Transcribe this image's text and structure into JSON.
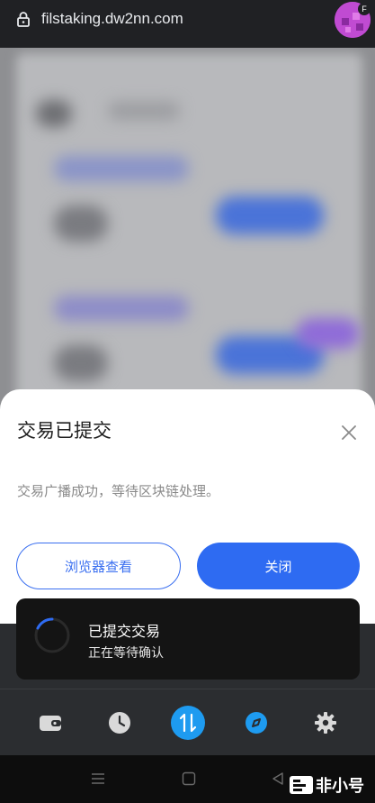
{
  "browser": {
    "url": "filstaking.dw2nn.com",
    "avatar_badge": "F"
  },
  "sheet": {
    "title": "交易已提交",
    "message": "交易广播成功，等待区块链处理。",
    "view_in_browser_label": "浏览器查看",
    "close_label": "关闭"
  },
  "toast": {
    "title": "已提交交易",
    "subtitle": "正在等待确认"
  },
  "bottom_nav": {
    "items": [
      {
        "icon": "wallet-icon"
      },
      {
        "icon": "clock-icon"
      },
      {
        "icon": "swap-icon",
        "active": true
      },
      {
        "icon": "compass-icon"
      },
      {
        "icon": "gear-icon"
      }
    ]
  },
  "watermark": {
    "text": "非小号"
  },
  "colors": {
    "accent": "#2e6bf2",
    "nav_active": "#1e9bf0",
    "toast_bg": "#141414"
  }
}
